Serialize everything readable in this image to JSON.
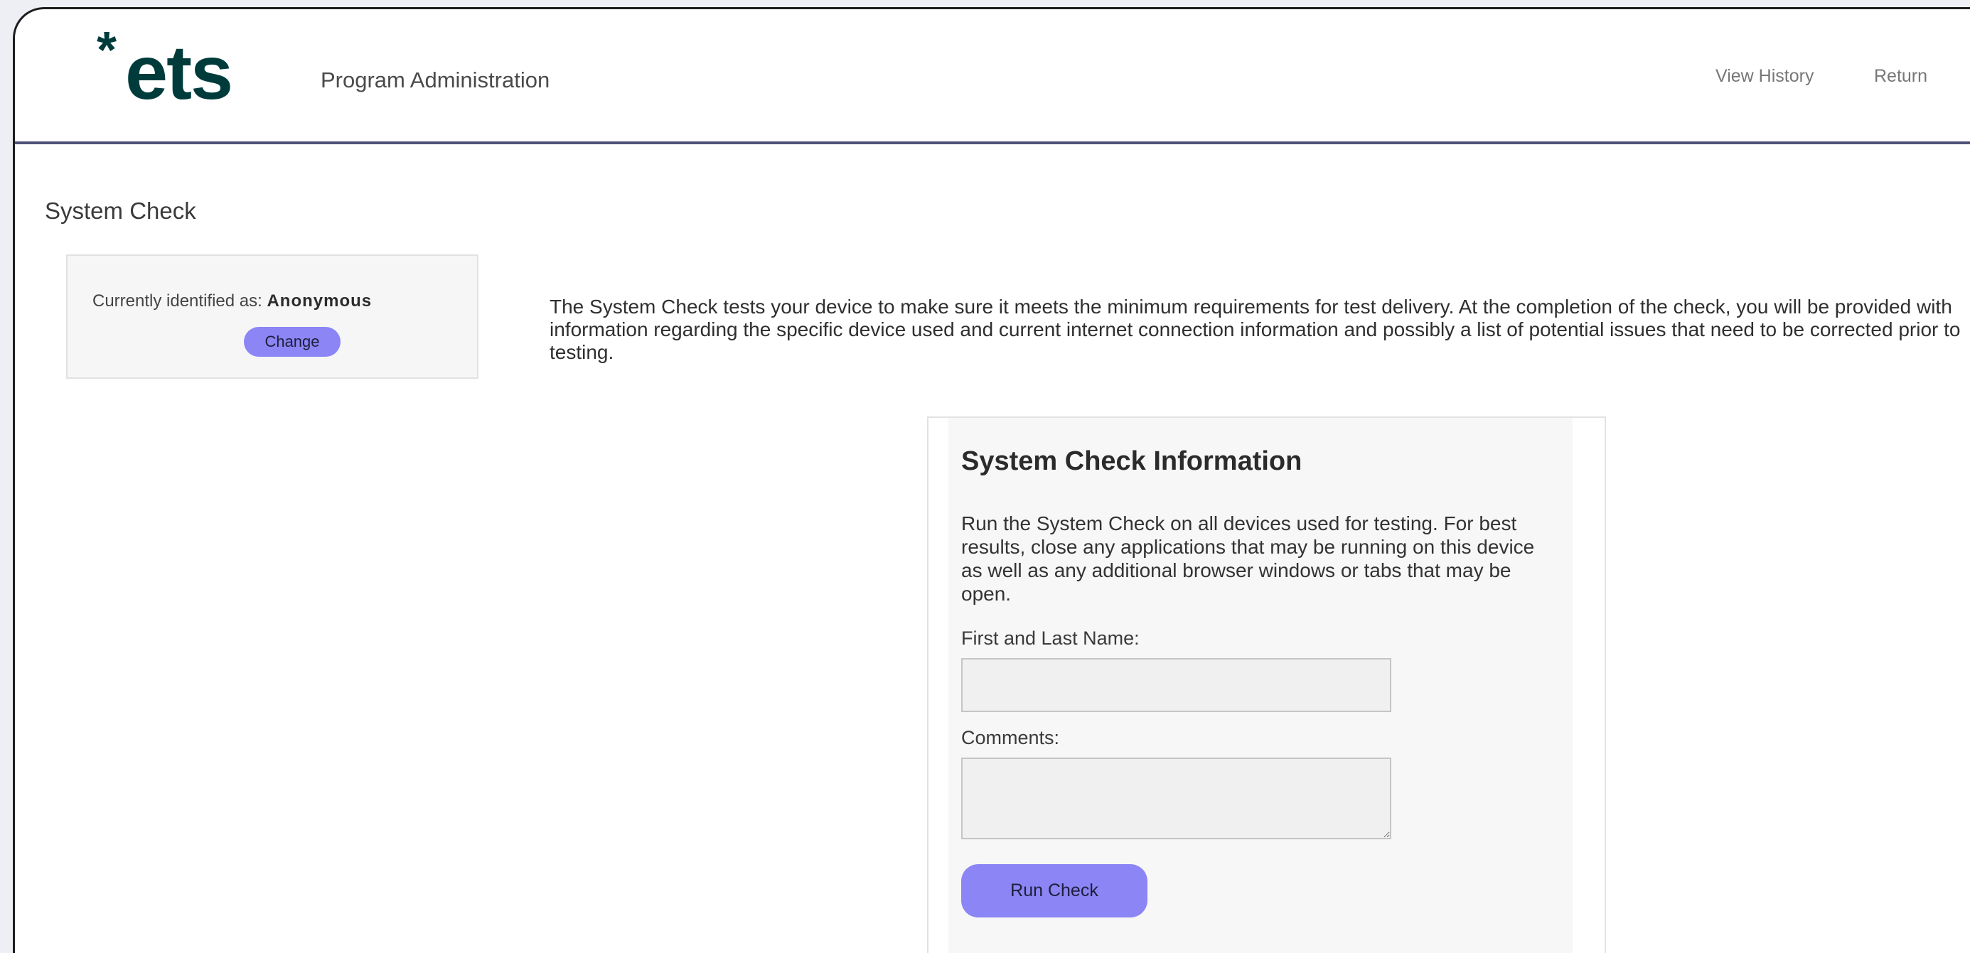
{
  "header": {
    "logo_star": "*",
    "logo_text": "ets",
    "title": "Program Administration",
    "links": {
      "view_history": "View History",
      "return": "Return"
    }
  },
  "page": {
    "title": "System Check"
  },
  "identity": {
    "label": "Currently identified as:",
    "value": "Anonymous",
    "change_button": "Change"
  },
  "intro": {
    "text": "The System Check tests your device to make sure it meets the minimum requirements for test delivery. At the completion of the check, you will be provided with information regarding the specific device used and current internet connection information and possibly a list of potential issues that need to be corrected prior to testing."
  },
  "info_card": {
    "title": "System Check Information",
    "description": "Run the System Check on all devices used for testing. For best results, close any applications that may be running on this device as well as any additional browser windows or tabs that may be open.",
    "name_label": "First and Last Name:",
    "name_value": "",
    "comments_label": "Comments:",
    "comments_value": "",
    "run_button": "Run Check"
  },
  "colors": {
    "accent_button": "#8b85f5",
    "header_rule": "#50507a",
    "logo": "#003b3c"
  }
}
